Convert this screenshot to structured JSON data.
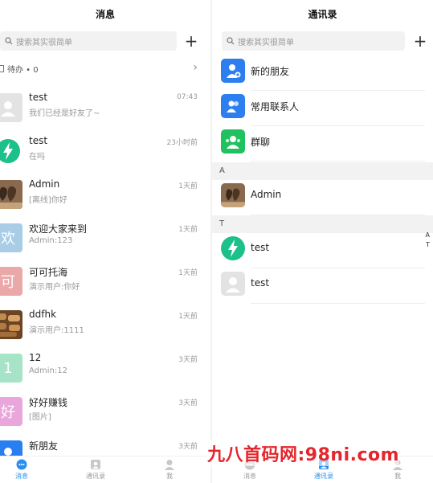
{
  "messages_screen": {
    "title": "消息",
    "search_placeholder": "搜索其实很简单",
    "todo_label": "待办 • 0",
    "conversations": [
      {
        "name": "test",
        "message": "我们已经是好友了~",
        "time": "07:43",
        "avatar": "default-person",
        "color": "#e0e0e0"
      },
      {
        "name": "test",
        "message": "在吗",
        "time": "23小时前",
        "avatar": "lightning",
        "color": "#1cc08a"
      },
      {
        "name": "Admin",
        "message": "[离线]你好",
        "time": "1天前",
        "avatar": "photo-hearts",
        "color": "#6b4a33"
      },
      {
        "name": "欢迎大家来到",
        "message": "Admin:123",
        "time": "1天前",
        "avatar": "欢",
        "color": "#a9cde6"
      },
      {
        "name": "可可托海",
        "message": "演示用户:你好",
        "time": "1天前",
        "avatar": "可",
        "color": "#eaa8a8"
      },
      {
        "name": "ddfhk",
        "message": "演示用户:1111",
        "time": "1天前",
        "avatar": "photo-bread",
        "color": "#9b6a3d"
      },
      {
        "name": "12",
        "message": "Admin:12",
        "time": "3天前",
        "avatar": "1",
        "color": "#a6e3c7"
      },
      {
        "name": "好好赚钱",
        "message": "[图片]",
        "time": "3天前",
        "avatar": "好",
        "color": "#e8a6db"
      },
      {
        "name": "新朋友",
        "message": "",
        "time": "3天前",
        "avatar": "blue-person",
        "color": "#2a7ff0"
      }
    ],
    "tabs": [
      {
        "label": "消息",
        "active": true
      },
      {
        "label": "通讯录",
        "active": false
      },
      {
        "label": "我",
        "active": false
      }
    ]
  },
  "contacts_screen": {
    "title": "通讯录",
    "search_placeholder": "搜索其实很简单",
    "menu": [
      {
        "label": "新的朋友",
        "icon": "new-friend-icon",
        "color": "#2d7ff0"
      },
      {
        "label": "常用联系人",
        "icon": "contacts-icon",
        "color": "#2d7ff0"
      },
      {
        "label": "群聊",
        "icon": "group-chat-icon",
        "color": "#1fc25e"
      }
    ],
    "sections": [
      {
        "letter": "A",
        "contacts": [
          {
            "name": "Admin",
            "avatar": "photo-hearts"
          }
        ]
      },
      {
        "letter": "T",
        "contacts": [
          {
            "name": "test",
            "avatar": "lightning"
          },
          {
            "name": "test",
            "avatar": "default-person"
          }
        ]
      }
    ],
    "index_letters": [
      "A",
      "T"
    ],
    "tabs": [
      {
        "label": "消息",
        "active": false
      },
      {
        "label": "通讯录",
        "active": true
      },
      {
        "label": "我",
        "active": false
      }
    ]
  },
  "watermark": "九八首码网:98ni.com",
  "accent_color": "#2a8ff0"
}
